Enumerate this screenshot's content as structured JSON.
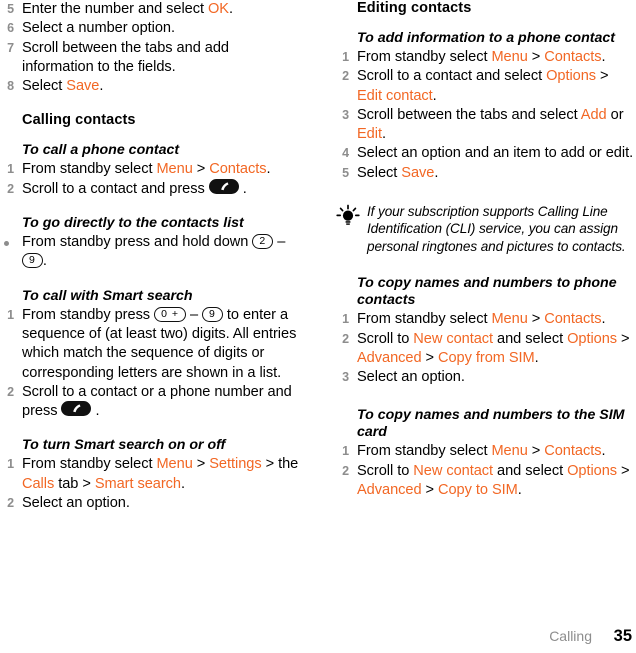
{
  "accent_color": "#f26724",
  "muted_color": "#8d8d8d",
  "left_column": {
    "continued_steps": [
      {
        "num": "5",
        "text_parts": [
          {
            "t": "Enter the number and select "
          },
          {
            "t": "OK",
            "c": "accent"
          },
          {
            "t": "."
          }
        ]
      },
      {
        "num": "6",
        "text_parts": [
          {
            "t": "Select a number option."
          }
        ]
      },
      {
        "num": "7",
        "text_parts": [
          {
            "t": "Scroll between the tabs and add information to the fields."
          }
        ]
      },
      {
        "num": "8",
        "text_parts": [
          {
            "t": "Select "
          },
          {
            "t": "Save",
            "c": "accent"
          },
          {
            "t": "."
          }
        ]
      }
    ],
    "section_title": "Calling contacts",
    "task_1": {
      "title": "To call a phone contact",
      "steps": [
        {
          "num": "1",
          "text_parts": [
            {
              "t": "From standby select "
            },
            {
              "t": "Menu",
              "c": "accent"
            },
            {
              "t": " > "
            },
            {
              "t": "Contacts",
              "c": "accent"
            },
            {
              "t": "."
            }
          ]
        },
        {
          "num": "2",
          "text_parts": [
            {
              "t": "Scroll to a contact and press "
            },
            {
              "icon": "call-pill"
            },
            {
              "t": " ."
            }
          ]
        }
      ]
    },
    "task_2": {
      "title": "To go directly to the contacts list",
      "steps": [
        {
          "bullet": true,
          "text_parts": [
            {
              "t": "From standby press and hold down "
            },
            {
              "key": "2"
            },
            {
              "t": " – "
            },
            {
              "key": "9"
            },
            {
              "t": "."
            }
          ]
        }
      ]
    },
    "task_3": {
      "title": "To call with Smart search",
      "steps": [
        {
          "num": "1",
          "text_parts": [
            {
              "t": "From standby press "
            },
            {
              "key": "0 +"
            },
            {
              "t": " – "
            },
            {
              "key": "9"
            },
            {
              "t": " to enter a sequence of (at least two) digits. All entries which match the sequence of digits or corresponding letters are shown in a list."
            }
          ]
        },
        {
          "num": "2",
          "text_parts": [
            {
              "t": "Scroll to a contact or a phone number and press "
            },
            {
              "icon": "call-pill"
            },
            {
              "t": " ."
            }
          ]
        }
      ]
    },
    "task_4": {
      "title": "To turn Smart search on or off",
      "steps": [
        {
          "num": "1",
          "text_parts": [
            {
              "t": "From standby select "
            },
            {
              "t": "Menu",
              "c": "accent"
            },
            {
              "t": " > "
            },
            {
              "t": "Settings",
              "c": "accent"
            },
            {
              "t": " > the "
            },
            {
              "t": "Calls",
              "c": "accent"
            },
            {
              "t": " tab > "
            },
            {
              "t": "Smart search",
              "c": "accent"
            },
            {
              "t": "."
            }
          ]
        },
        {
          "num": "2",
          "text_parts": [
            {
              "t": "Select an option."
            }
          ]
        }
      ]
    }
  },
  "right_column": {
    "section_title": "Editing contacts",
    "task_1": {
      "title": "To add information to a phone contact",
      "steps": [
        {
          "num": "1",
          "text_parts": [
            {
              "t": "From standby select "
            },
            {
              "t": "Menu",
              "c": "accent"
            },
            {
              "t": " > "
            },
            {
              "t": "Contacts",
              "c": "accent"
            },
            {
              "t": "."
            }
          ]
        },
        {
          "num": "2",
          "text_parts": [
            {
              "t": "Scroll to a contact and select "
            },
            {
              "t": "Options",
              "c": "accent"
            },
            {
              "t": " > "
            },
            {
              "t": "Edit contact",
              "c": "accent"
            },
            {
              "t": "."
            }
          ]
        },
        {
          "num": "3",
          "text_parts": [
            {
              "t": "Scroll between the tabs and select "
            },
            {
              "t": "Add",
              "c": "accent"
            },
            {
              "t": " or "
            },
            {
              "t": "Edit",
              "c": "accent"
            },
            {
              "t": "."
            }
          ]
        },
        {
          "num": "4",
          "text_parts": [
            {
              "t": "Select an option and an item to add or edit."
            }
          ]
        },
        {
          "num": "5",
          "text_parts": [
            {
              "t": "Select "
            },
            {
              "t": "Save",
              "c": "accent"
            },
            {
              "t": "."
            }
          ]
        }
      ]
    },
    "tip": {
      "icon": "lightbulb-icon",
      "text": "If your subscription supports Calling Line Identification (CLI) service, you can assign personal ringtones and pictures to contacts."
    },
    "task_2": {
      "title": "To copy names and numbers to phone contacts",
      "steps": [
        {
          "num": "1",
          "text_parts": [
            {
              "t": "From standby select "
            },
            {
              "t": "Menu",
              "c": "accent"
            },
            {
              "t": " > "
            },
            {
              "t": "Contacts",
              "c": "accent"
            },
            {
              "t": "."
            }
          ]
        },
        {
          "num": "2",
          "text_parts": [
            {
              "t": "Scroll to "
            },
            {
              "t": "New contact",
              "c": "accent"
            },
            {
              "t": " and select "
            },
            {
              "t": "Options",
              "c": "accent"
            },
            {
              "t": " > "
            },
            {
              "t": "Advanced",
              "c": "accent"
            },
            {
              "t": " > "
            },
            {
              "t": "Copy from SIM",
              "c": "accent"
            },
            {
              "t": "."
            }
          ]
        },
        {
          "num": "3",
          "text_parts": [
            {
              "t": "Select an option."
            }
          ]
        }
      ]
    },
    "task_3": {
      "title": "To copy names and numbers to the SIM card",
      "steps": [
        {
          "num": "1",
          "text_parts": [
            {
              "t": "From standby select "
            },
            {
              "t": "Menu",
              "c": "accent"
            },
            {
              "t": " > "
            },
            {
              "t": "Contacts",
              "c": "accent"
            },
            {
              "t": "."
            }
          ]
        },
        {
          "num": "2",
          "text_parts": [
            {
              "t": "Scroll to "
            },
            {
              "t": "New contact",
              "c": "accent"
            },
            {
              "t": " and select "
            },
            {
              "t": "Options",
              "c": "accent"
            },
            {
              "t": " > "
            },
            {
              "t": "Advanced",
              "c": "accent"
            },
            {
              "t": " > "
            },
            {
              "t": "Copy to SIM",
              "c": "accent"
            },
            {
              "t": "."
            }
          ]
        }
      ]
    }
  },
  "footer": {
    "chapter": "Calling",
    "page_number": "35"
  }
}
